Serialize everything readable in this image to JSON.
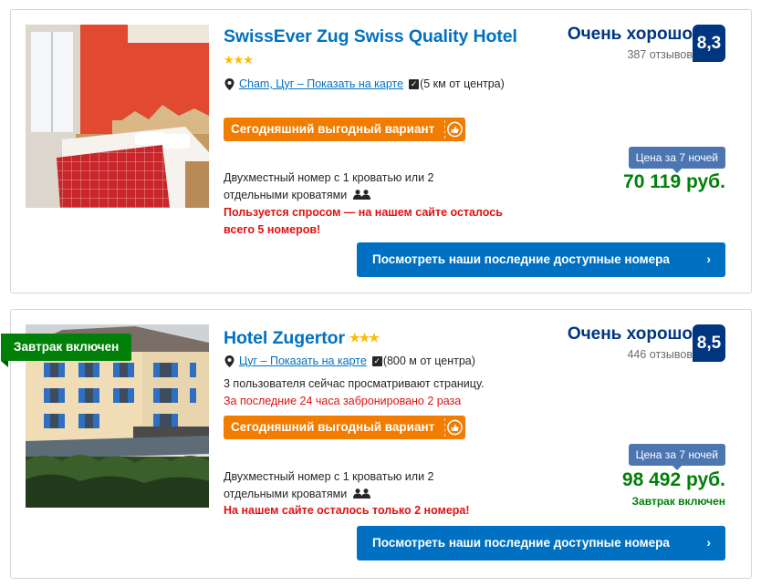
{
  "hotels": [
    {
      "name": "SwissEver Zug Swiss Quality Hotel",
      "stars": "★★★",
      "location_link": "Cham, Цуг – Показать на карте",
      "distance": "(5 км от центра)",
      "deal_badge": "Сегодняшний выгодный вариант",
      "room_line1": "Двухместный номер с 1 кроватью или 2",
      "room_line2": "отдельными кроватями",
      "urgency_line1": "Пользуется спросом — на нашем сайте осталось",
      "urgency_line2": "всего 5 номеров!",
      "review_word": "Очень хорошо",
      "review_count": "387 отзывов",
      "score": "8,3",
      "price_label": "Цена за 7 ночей",
      "price": "70 119 руб.",
      "cta": "Посмотреть наши последние доступные номера",
      "cta_chevron": "›"
    },
    {
      "name": "Hotel Zugertor",
      "stars": "★★★",
      "location_link": "Цуг – Показать на карте",
      "distance": "(800 м от центра)",
      "viewing_now": "3 пользователя сейчас просматривают страницу.",
      "booked_recently": "За последние 24 часа забронировано 2 раза",
      "deal_badge": "Сегодняшний выгодный вариант",
      "room_line1": "Двухместный номер с 1 кроватью или 2",
      "room_line2": "отдельными кроватями",
      "urgency_line1": "На нашем сайте осталось только 2 номера!",
      "review_word": "Очень хорошо",
      "review_count": "446 отзывов",
      "score": "8,5",
      "price_label": "Цена за 7 ночей",
      "price": "98 492 руб.",
      "price_note": "Завтрак включен",
      "ribbon": "Завтрак включен",
      "cta": "Посмотреть наши последние доступные номера",
      "cta_chevron": "›"
    }
  ],
  "icons": {
    "location": "map-pin-icon",
    "distance": "checkbox-icon",
    "people": "two-people-icon",
    "deal": "thumbs-up-badge-icon"
  },
  "colors": {
    "brand_blue": "#0071c2",
    "navy": "#003580",
    "deal_orange": "#f17c00",
    "price_green": "#008009",
    "urgency_red": "#e21111",
    "star_yellow": "#febb02",
    "price_label_blue": "#4c76b2"
  }
}
